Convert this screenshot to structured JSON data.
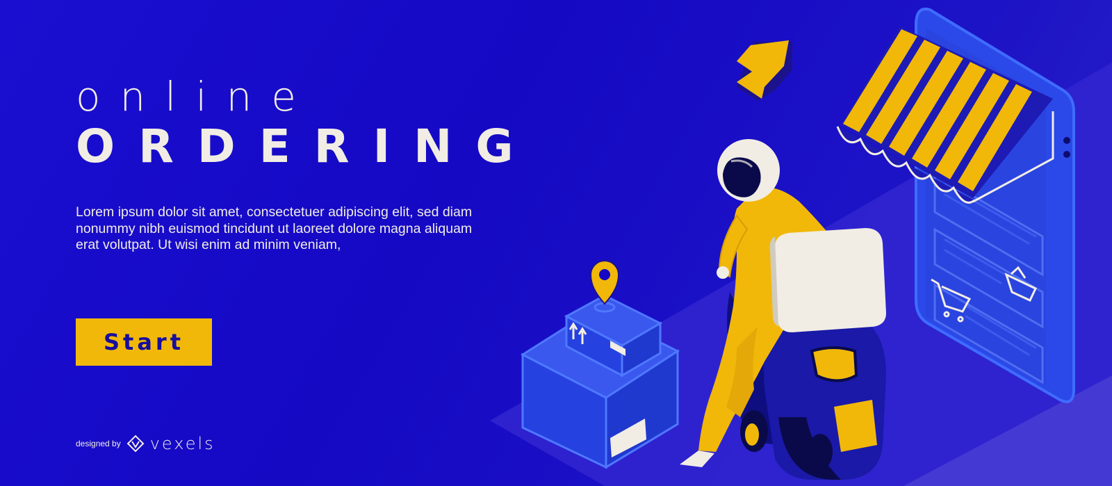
{
  "hero": {
    "title_small": "online",
    "title_big": "ORDERING",
    "body": "Lorem ipsum dolor sit amet, consectetuer adipiscing elit, sed diam nonummy nibh euismod tincidunt ut laoreet dolore magna aliquam erat volutpat. Ut wisi enim ad minim veniam,",
    "start_label": "Start"
  },
  "credit": {
    "prefix": "designed by",
    "brand": "vexels"
  },
  "illustration": {
    "icons": [
      "arrow-icon",
      "location-pin-icon",
      "delivery-rider-icon",
      "scooter-icon",
      "package-box-icon",
      "shop-phone-icon",
      "shopping-cart-icon",
      "shopping-basket-icon",
      "awning-icon"
    ],
    "colors": {
      "background": "#1509c4",
      "accent_yellow": "#f1b80a",
      "cream": "#f1ede4",
      "light_blue": "#3a57ee",
      "navy": "#0d0c6e"
    }
  }
}
